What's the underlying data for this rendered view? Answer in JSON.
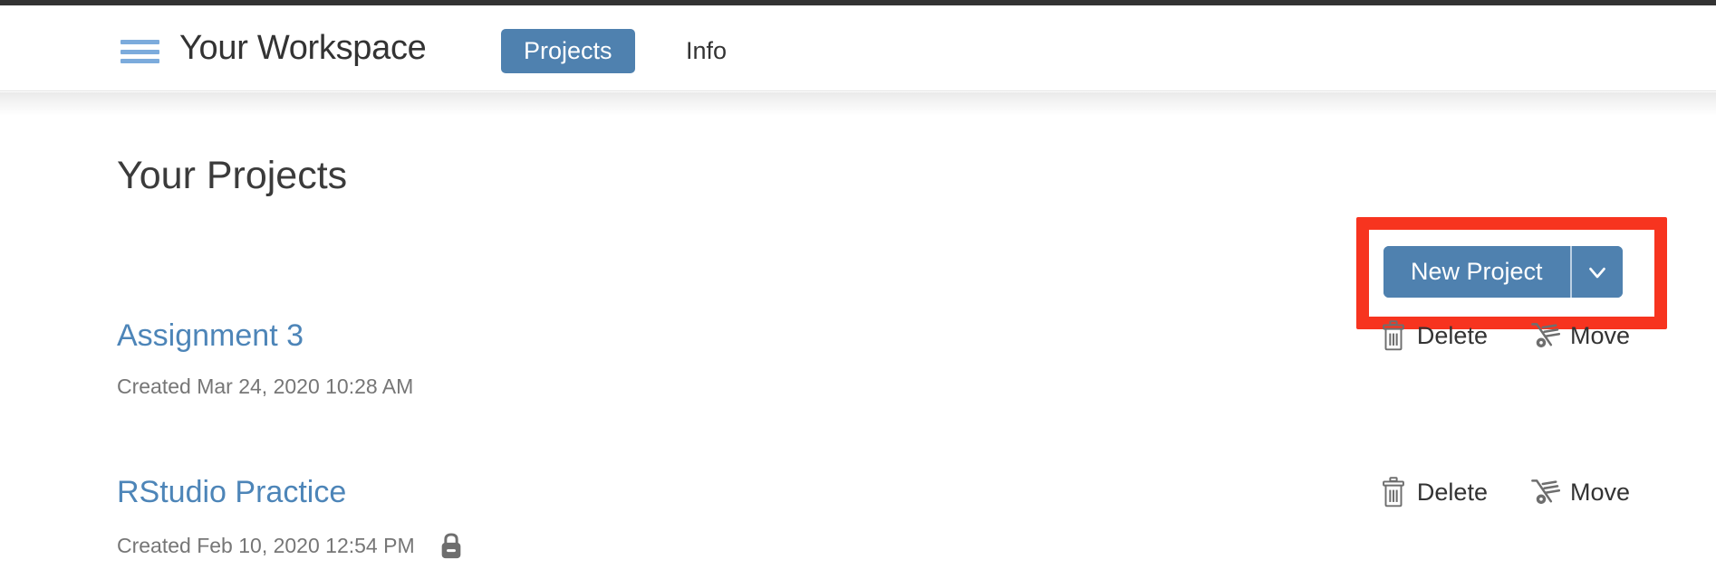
{
  "header": {
    "menu_icon": "hamburger-icon",
    "workspace_title": "Your Workspace",
    "tabs": [
      {
        "label": "Projects",
        "active": true
      },
      {
        "label": "Info",
        "active": false
      }
    ]
  },
  "main": {
    "page_title": "Your Projects",
    "new_project": {
      "label": "New Project",
      "caret_icon": "chevron-down-icon",
      "highlighted": true
    },
    "projects": [
      {
        "name": "Assignment 3",
        "created": "Created Mar 24, 2020 10:28 AM",
        "locked": false,
        "actions": [
          {
            "label": "Delete",
            "icon": "trash-icon"
          },
          {
            "label": "Move",
            "icon": "hand-truck-icon"
          }
        ]
      },
      {
        "name": "RStudio Practice",
        "created": "Created Feb 10, 2020 12:54 PM",
        "locked": true,
        "lock_icon": "lock-icon",
        "actions": [
          {
            "label": "Delete",
            "icon": "trash-icon"
          },
          {
            "label": "Move",
            "icon": "hand-truck-icon"
          }
        ]
      }
    ]
  },
  "colors": {
    "accent_blue": "#4F81AF",
    "link_blue": "#4D85B8",
    "hamburger_blue": "#7CABDC",
    "highlight_red": "#F7341F",
    "text_dark": "#333333",
    "text_muted": "#767676"
  }
}
